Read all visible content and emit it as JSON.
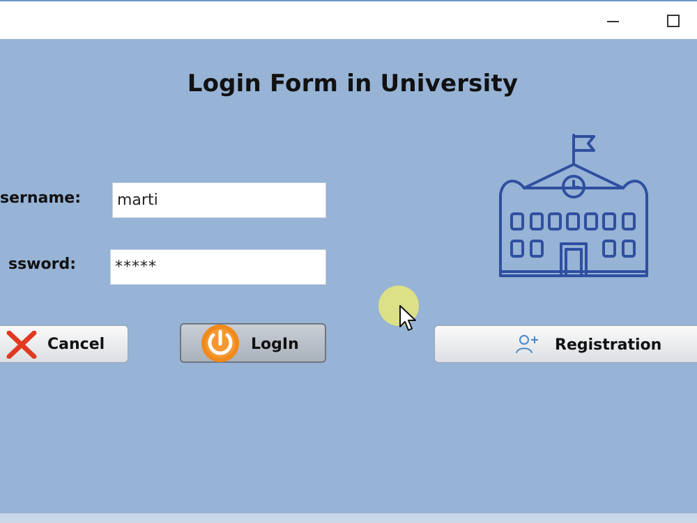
{
  "window": {
    "minimize_icon": "minimize-icon",
    "maximize_icon": "maximize-icon"
  },
  "form": {
    "title": "Login Form in University",
    "username_label": "sername:",
    "password_label": "ssword:",
    "username_value": "marti",
    "password_value": "*****"
  },
  "buttons": {
    "cancel_label": "Cancel",
    "login_label": "LogIn",
    "registration_label": "Registration"
  },
  "icons": {
    "cancel": "close-x-icon",
    "login": "power-icon",
    "registration": "add-user-icon",
    "illustration": "school-building-icon"
  },
  "colors": {
    "background": "#97b3d6",
    "illustration": "#2f4fa0",
    "power_orange": "#f08a1c",
    "cancel_red": "#e03a22"
  }
}
